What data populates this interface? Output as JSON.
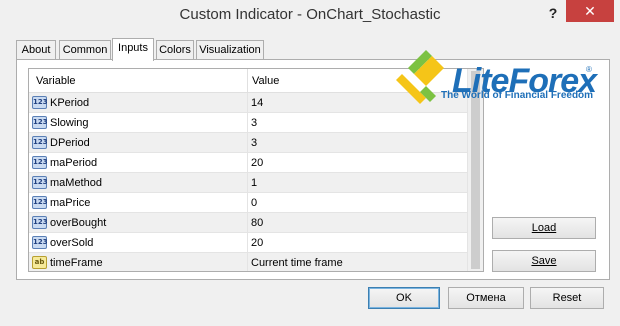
{
  "window": {
    "title": "Custom Indicator - OnChart_Stochastic",
    "help_label": "?",
    "close_label": "✕"
  },
  "tabs": [
    {
      "label": "About"
    },
    {
      "label": "Common"
    },
    {
      "label": "Inputs",
      "active": true
    },
    {
      "label": "Colors"
    },
    {
      "label": "Visualization"
    }
  ],
  "grid": {
    "col_variable": "Variable",
    "col_value": "Value",
    "rows": [
      {
        "type_icon": "123",
        "variable": "KPeriod",
        "value": "14"
      },
      {
        "type_icon": "123",
        "variable": "Slowing",
        "value": "3"
      },
      {
        "type_icon": "123",
        "variable": "DPeriod",
        "value": "3"
      },
      {
        "type_icon": "123",
        "variable": "maPeriod",
        "value": "20"
      },
      {
        "type_icon": "123",
        "variable": "maMethod",
        "value": "1"
      },
      {
        "type_icon": "123",
        "variable": "maPrice",
        "value": "0"
      },
      {
        "type_icon": "123",
        "variable": "overBought",
        "value": "80"
      },
      {
        "type_icon": "123",
        "variable": "overSold",
        "value": "20"
      },
      {
        "type_icon": "ab",
        "variable": "timeFrame",
        "value": "Current time frame"
      }
    ]
  },
  "buttons": {
    "load": "Load",
    "save": "Save",
    "ok": "OK",
    "cancel": "Отмена",
    "reset": "Reset"
  },
  "logo": {
    "brand": "LiteForex",
    "reg": "®",
    "tagline": "The World of Financial Freedom",
    "colors": {
      "blue": "#1e6fb8",
      "green": "#7cc242",
      "yellow": "#f5c518"
    }
  },
  "colors": {
    "close_button": "#c7413f",
    "default_button_border": "#3c7fb1"
  }
}
